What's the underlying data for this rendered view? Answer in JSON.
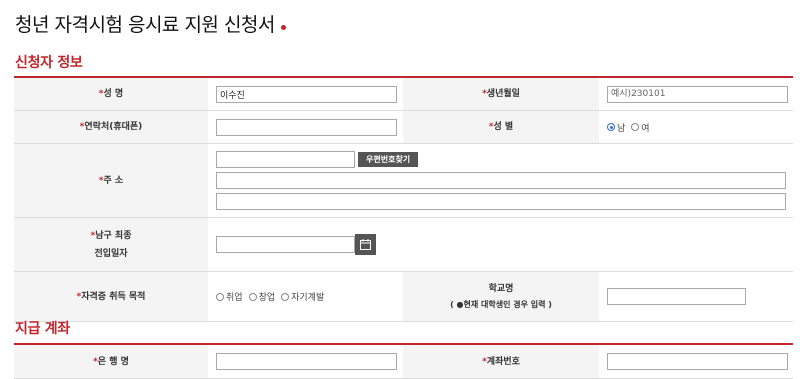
{
  "title": "청년 자격시험 응시료 지원 신청서",
  "sections": {
    "applicant": "신청자 정보",
    "account": "지급 계좌"
  },
  "required_mark": "*",
  "fields": {
    "name": {
      "label": "성    명",
      "value": "이수진"
    },
    "birth": {
      "label": "생년월일",
      "placeholder": "예시)230101"
    },
    "phone": {
      "label": "연락처(휴대폰)",
      "value": ""
    },
    "gender": {
      "label": "성    별",
      "options": [
        "남",
        "여"
      ],
      "selected": "남"
    },
    "address": {
      "label": "주    소",
      "zip_button": "우편번호찾기"
    },
    "move_in": {
      "label_line1": "남구 최종",
      "label_line2": "전입일자"
    },
    "purpose": {
      "label": "자격증 취득 목적",
      "options": [
        "취업",
        "창업",
        "자기계발"
      ]
    },
    "school": {
      "label": "학교명",
      "note": "( ●현재 대학생인 경우 입력 )"
    },
    "bank": {
      "label": "은 행 명"
    },
    "account_no": {
      "label": "계좌번호"
    }
  },
  "icons": {
    "calendar": "calendar-icon"
  },
  "colors": {
    "accent": "#c0272d",
    "label_bg": "#f4f4f4",
    "button_bg": "#555555"
  }
}
